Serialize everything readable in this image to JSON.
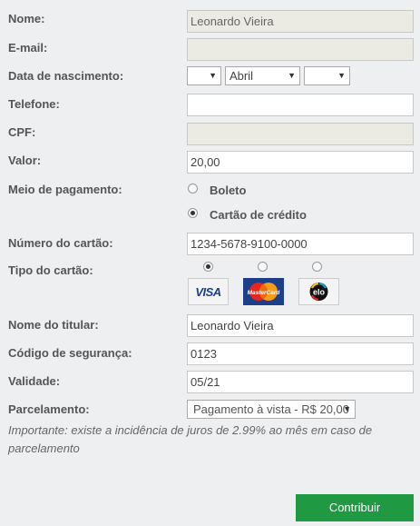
{
  "labels": {
    "nome": "Nome:",
    "email": "E-mail:",
    "nascimento": "Data de nascimento:",
    "telefone": "Telefone:",
    "cpf": "CPF:",
    "valor": "Valor:",
    "meio": "Meio de pagamento:",
    "numero_cartao": "Número do cartão:",
    "tipo_cartao": "Tipo do cartão:",
    "titular": "Nome do titular:",
    "codigo": "Código de segurança:",
    "validade": "Validade:",
    "parcelamento": "Parcelamento:"
  },
  "values": {
    "nome": "Leonardo Vieira",
    "email": "",
    "nasc_dia": "",
    "nasc_mes": "Abril",
    "nasc_ano": "",
    "telefone": "",
    "cpf": "",
    "valor": "20,00",
    "numero_cartao": "1234-5678-9100-0000",
    "titular": "Leonardo Vieira",
    "codigo": "0123",
    "validade": "05/21",
    "parcelamento": "Pagamento à vista - R$ 20,00"
  },
  "payment_options": {
    "boleto": "Boleto",
    "cartao": "Cartão de crédito",
    "selected": "cartao"
  },
  "card_brands": {
    "visa": "VISA",
    "mastercard": "MasterCard",
    "elo": "elo",
    "selected": "visa"
  },
  "icons": {
    "dropdown": "chevron-down-icon"
  },
  "note": "Importante: existe a incidência de juros de 2.99% ao mês em caso de parcelamento",
  "submit_label": "Contribuir",
  "colors": {
    "background": "#eeeff0",
    "accent": "#1f9a43",
    "disabled_field": "#ebebe4"
  }
}
